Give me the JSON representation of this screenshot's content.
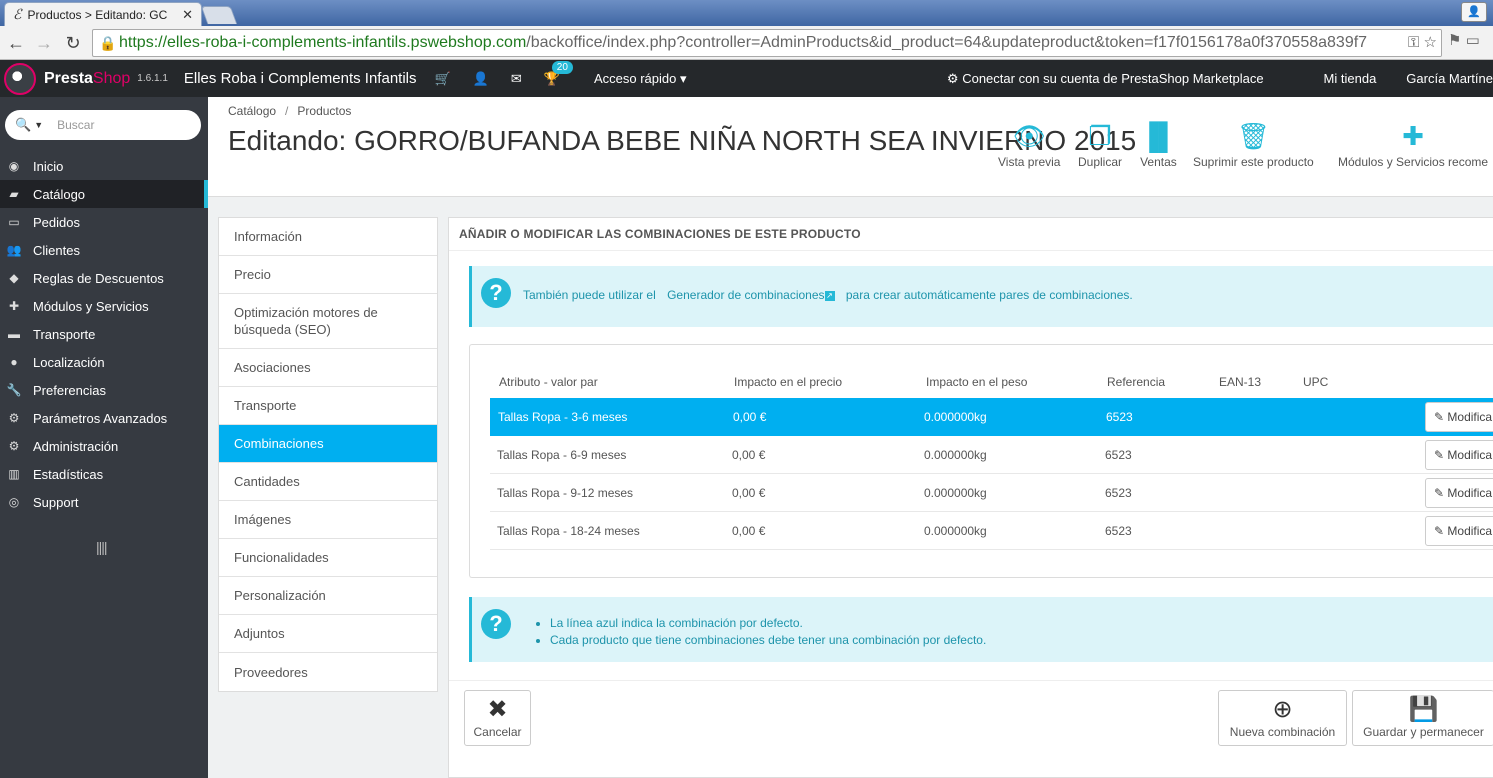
{
  "browser": {
    "tab_title": "Productos > Editando: GC",
    "url_host": "https://elles-roba-i-complements-infantils.pswebshop.com",
    "url_path": "/backoffice/index.php?controller=AdminProducts&id_product=64&updateproduct&token=f17f0156178a0f370558a839f7"
  },
  "header": {
    "logo_a": "Presta",
    "logo_b": "Shop",
    "version": "1.6.1.1",
    "shop_name": "Elles Roba i Complements Infantils",
    "notif_count": "20",
    "quick_access": "Acceso rápido",
    "marketplace": "Conectar con su cuenta de PrestaShop Marketplace",
    "my_shop": "Mi tienda",
    "user": "García Martíne"
  },
  "search": {
    "placeholder": "Buscar"
  },
  "sidebar": {
    "items": [
      {
        "label": "Inicio",
        "icon": "dashboard-icon"
      },
      {
        "label": "Catálogo",
        "icon": "book-icon"
      },
      {
        "label": "Pedidos",
        "icon": "credit-card-icon"
      },
      {
        "label": "Clientes",
        "icon": "users-icon"
      },
      {
        "label": "Reglas de Descuentos",
        "icon": "tag-icon"
      },
      {
        "label": "Módulos y Servicios",
        "icon": "puzzle-icon"
      },
      {
        "label": "Transporte",
        "icon": "truck-icon"
      },
      {
        "label": "Localización",
        "icon": "globe-icon"
      },
      {
        "label": "Preferencias",
        "icon": "wrench-icon"
      },
      {
        "label": "Parámetros Avanzados",
        "icon": "cogs-icon"
      },
      {
        "label": "Administración",
        "icon": "cog-icon"
      },
      {
        "label": "Estadísticas",
        "icon": "bar-chart-icon"
      },
      {
        "label": "Support",
        "icon": "lifebuoy-icon"
      }
    ]
  },
  "page": {
    "breadcrumb_1": "Catálogo",
    "breadcrumb_2": "Productos",
    "title": "Editando: GORRO/BUFANDA BEBE NIÑA NORTH SEA INVIERNO 2015"
  },
  "toolbar": {
    "preview": "Vista previa",
    "duplicate": "Duplicar",
    "sales": "Ventas",
    "delete": "Suprimir este producto",
    "modules": "Módulos y Servicios recome"
  },
  "product_tabs": [
    "Información",
    "Precio",
    "Optimización motores de búsqueda (SEO)",
    "Asociaciones",
    "Transporte",
    "Combinaciones",
    "Cantidades",
    "Imágenes",
    "Funcionalidades",
    "Personalización",
    "Adjuntos",
    "Proveedores"
  ],
  "panel": {
    "heading": "AÑADIR O MODIFICAR LAS COMBINACIONES DE ESTE PRODUCTO",
    "info_before": "También puede utilizar el",
    "info_link": "Generador de combinaciones",
    "info_after": "para crear automáticamente pares de combinaciones.",
    "table": {
      "headers": [
        "Atributo - valor par",
        "Impacto en el precio",
        "Impacto en el peso",
        "Referencia",
        "EAN-13",
        "UPC"
      ],
      "rows": [
        [
          "Tallas Ropa - 3-6 meses",
          "0,00 €",
          "0.000000kg",
          "6523"
        ],
        [
          "Tallas Ropa - 6-9 meses",
          "0,00 €",
          "0.000000kg",
          "6523"
        ],
        [
          "Tallas Ropa - 9-12 meses",
          "0,00 €",
          "0.000000kg",
          "6523"
        ],
        [
          "Tallas Ropa - 18-24 meses",
          "0,00 €",
          "0.000000kg",
          "6523"
        ]
      ],
      "modify_label": "Modifica"
    },
    "notes": [
      "La línea azul indica la combinación por defecto.",
      "Cada producto que tiene combinaciones debe tener una combinación por defecto."
    ],
    "cancel": "Cancelar",
    "new_combination": "Nueva combinación",
    "save_stay": "Guardar y permanecer"
  },
  "colors": {
    "accent": "#25b9d7",
    "active_row": "#00aff0",
    "sidebar": "#363a41",
    "header": "#25282b",
    "brand": "#df0067"
  }
}
